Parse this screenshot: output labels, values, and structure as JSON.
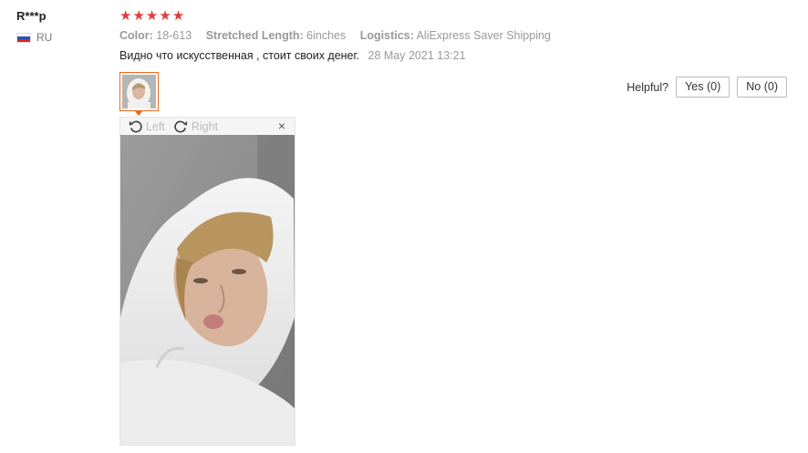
{
  "user": {
    "name": "R***p",
    "country": "RU"
  },
  "rating": {
    "stars": 5
  },
  "attributes": [
    {
      "key": "Color:",
      "value": "18-613"
    },
    {
      "key": "Stretched Length:",
      "value": "6inches"
    },
    {
      "key": "Logistics:",
      "value": "AliExpress Saver Shipping"
    }
  ],
  "review": {
    "text": "Видно что искусственная , стоит своих денег.",
    "date": "28 May 2021 13:21"
  },
  "helpful": {
    "label": "Helpful?",
    "yes": "Yes (0)",
    "no": "No (0)"
  },
  "viewer": {
    "rotate_left": "Left",
    "rotate_right": "Right",
    "close": "×"
  },
  "colors": {
    "star": "#e43a3a",
    "accent": "#f06a1c"
  }
}
